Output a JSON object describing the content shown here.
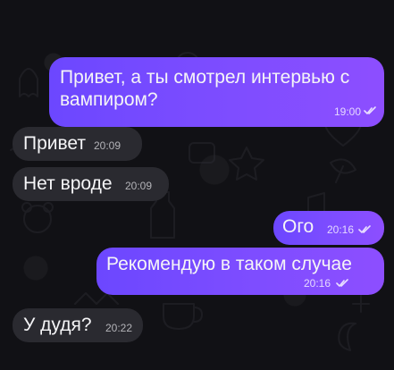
{
  "messages": [
    {
      "direction": "outgoing",
      "lines": [
        "Привет, а ты смотрел интервью с",
        "вампиром?"
      ],
      "time": "19:00",
      "read": true
    },
    {
      "direction": "incoming",
      "text": "Привет",
      "time": "20:09"
    },
    {
      "direction": "incoming",
      "text": "Нет вроде",
      "time": "20:09"
    },
    {
      "direction": "outgoing",
      "text": "Ого",
      "time": "20:16",
      "read": true
    },
    {
      "direction": "outgoing",
      "text": "Рекомендую в таком случае",
      "time": "20:16",
      "read": true
    },
    {
      "direction": "incoming",
      "text": "У дудя?",
      "time": "20:22"
    }
  ],
  "colors": {
    "background": "#111115",
    "incoming_bubble": "#2a2a30",
    "outgoing_bubble_start": "#6c47ff",
    "outgoing_bubble_end": "#8d4eff",
    "text": "#f5f5f7"
  },
  "icons": {
    "read_status": "double-check-icon"
  }
}
